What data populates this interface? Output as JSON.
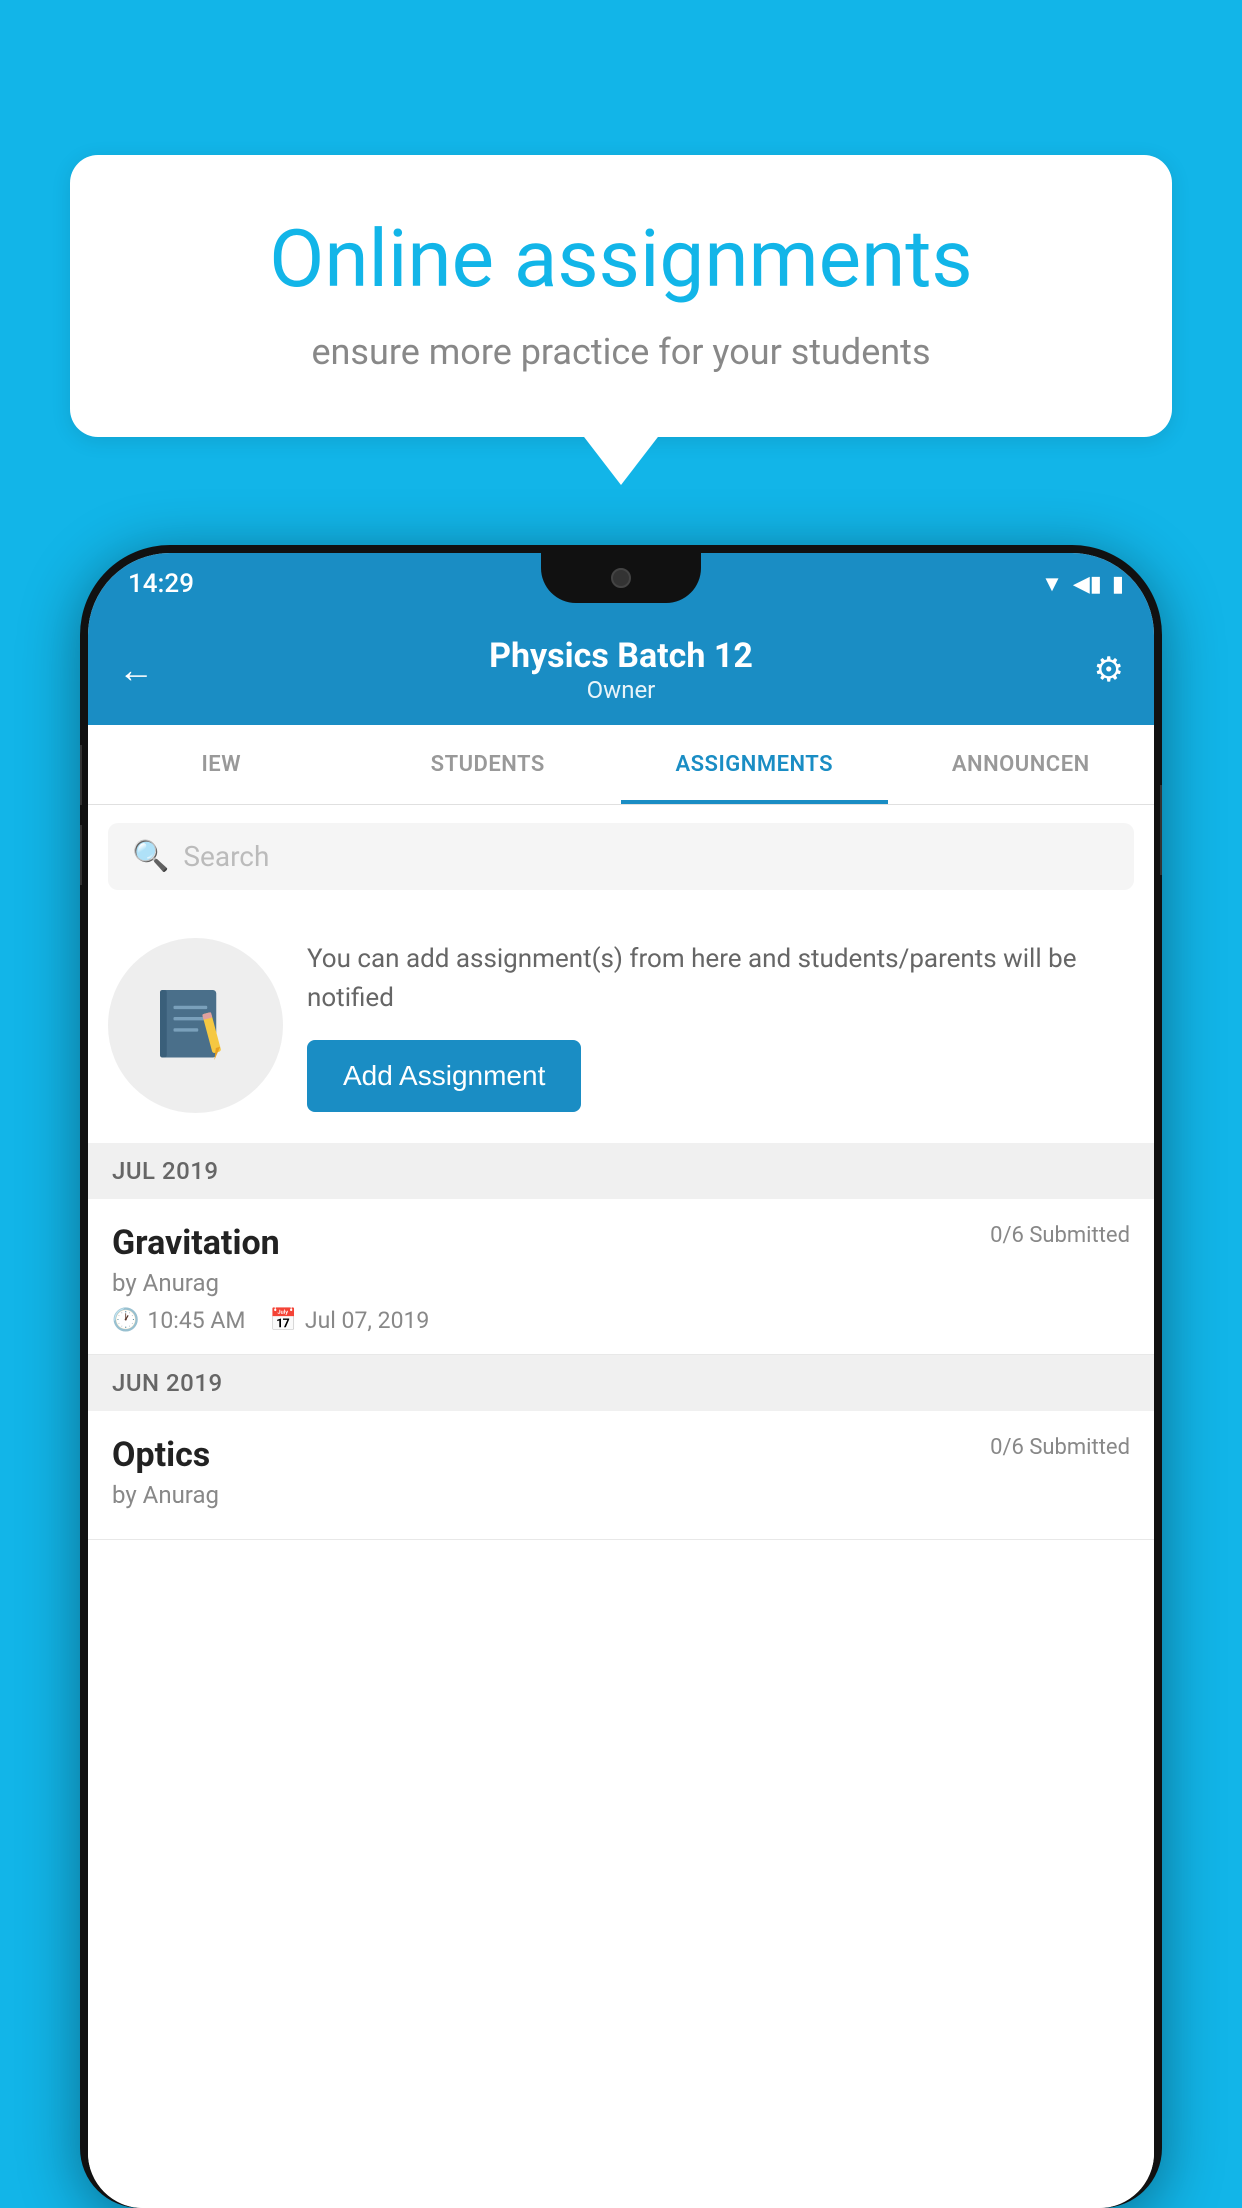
{
  "background_color": "#12b5e8",
  "speech_bubble": {
    "title": "Online assignments",
    "subtitle": "ensure more practice for your students"
  },
  "status_bar": {
    "time": "14:29",
    "wifi_icon": "▼",
    "signal_icon": "▲",
    "battery_icon": "▮"
  },
  "app_header": {
    "back_icon": "←",
    "title": "Physics Batch 12",
    "subtitle": "Owner",
    "settings_icon": "⚙"
  },
  "tabs": [
    {
      "label": "IEW",
      "active": false
    },
    {
      "label": "STUDENTS",
      "active": false
    },
    {
      "label": "ASSIGNMENTS",
      "active": true
    },
    {
      "label": "ANNOUNCEN",
      "active": false
    }
  ],
  "search": {
    "placeholder": "Search",
    "icon": "🔍"
  },
  "info_card": {
    "text": "You can add assignment(s) from here and students/parents will be notified",
    "button_label": "Add Assignment"
  },
  "sections": [
    {
      "label": "JUL 2019",
      "assignments": [
        {
          "title": "Gravitation",
          "submitted": "0/6 Submitted",
          "by": "by Anurag",
          "time": "10:45 AM",
          "date": "Jul 07, 2019"
        }
      ]
    },
    {
      "label": "JUN 2019",
      "assignments": [
        {
          "title": "Optics",
          "submitted": "0/6 Submitted",
          "by": "by Anurag",
          "time": "",
          "date": ""
        }
      ]
    }
  ]
}
